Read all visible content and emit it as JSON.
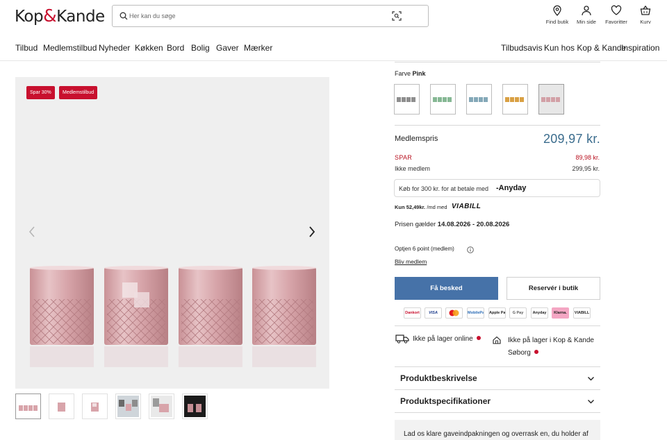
{
  "header": {
    "logo_left": "Kop",
    "logo_amp": "&",
    "logo_right": "Kande",
    "search_placeholder": "Her kan du søge",
    "actions": [
      {
        "label": "Find butik",
        "icon": "location-pin-icon"
      },
      {
        "label": "Min side",
        "icon": "user-icon"
      },
      {
        "label": "Favoritter",
        "icon": "heart-icon"
      },
      {
        "label": "Kurv",
        "icon": "basket-icon"
      }
    ]
  },
  "nav": {
    "left": [
      "Tilbud",
      "Medlemstilbud",
      "Nyheder",
      "Køkken",
      "Bord",
      "Bolig",
      "Gaver",
      "Mærker"
    ],
    "right": [
      "Tilbudsavis",
      "Kun hos Kop & Kande",
      "Inspiration"
    ]
  },
  "gallery": {
    "badges": [
      "Spar 30%",
      "Medlemstilbud"
    ],
    "thumbnail_count": 6,
    "colors": {
      "glass": "#d9a8ad",
      "badge": "#c8102e"
    }
  },
  "product": {
    "color_label": "Farve",
    "color_value": "Pink",
    "swatches": [
      {
        "name": "grey",
        "tint": "#9a9a9a"
      },
      {
        "name": "green",
        "tint": "#8fbf9b"
      },
      {
        "name": "blue",
        "tint": "#8fb0c0"
      },
      {
        "name": "amber",
        "tint": "#d9a34a"
      },
      {
        "name": "pink",
        "tint": "#d8a4aa",
        "selected": true
      }
    ],
    "member_price_label": "Medlemspris",
    "member_price": "209,97 kr.",
    "save_label": "SPAR",
    "save_value": "89,98 kr.",
    "non_member_label": "Ikke medlem",
    "non_member_price": "299,95 kr.",
    "anyday_text": "Køb for 300 kr. for at betale med",
    "anyday_brand": "Anyday",
    "viabill_prefix": "Kun",
    "viabill_amount": "52,49kr.",
    "viabill_suffix": "/md med",
    "viabill_brand": "VIABILL",
    "price_period_label": "Prisen gælder",
    "price_period": "14.08.2026 - 20.08.2026",
    "points_text": "Optjen 6 point (medlem)",
    "become_member": "Bliv medlem",
    "notify_button": "Få besked",
    "reserve_button": "Reservér i butik",
    "payment_methods": [
      "Dankort",
      "VISA",
      "Mastercard",
      "MobilePay",
      "Apple Pay",
      "G Pay",
      "Anyday",
      "Klarna.",
      "VIABILL"
    ],
    "stock_online": "Ikke på lager online",
    "stock_store": "Ikke på lager i Kop & Kande Søborg",
    "accordions": [
      "Produktbeskrivelse",
      "Produktspecifikationer"
    ],
    "gift_text": "Lad os klare gaveindpakningen og overrask en, du holder af"
  }
}
